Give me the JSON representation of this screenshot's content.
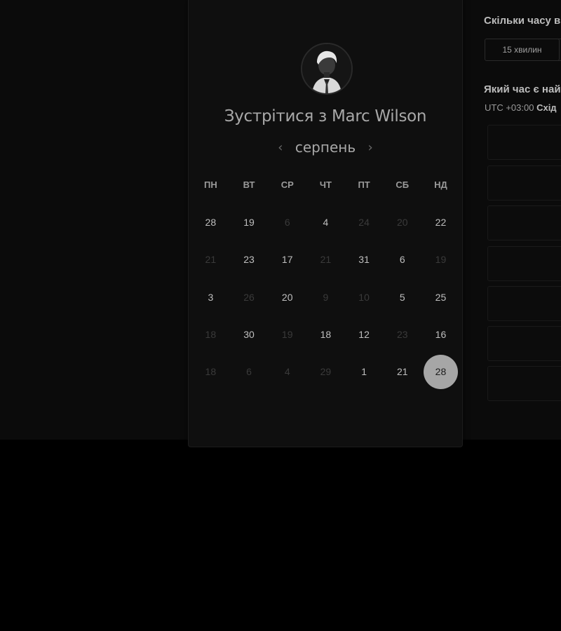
{
  "card": {
    "title_prefix": "Зустрітися з",
    "host_name": "Marc Wilson",
    "month": "серпень",
    "weekdays": [
      "ПН",
      "ВТ",
      "СР",
      "ЧТ",
      "ПТ",
      "СБ",
      "НД"
    ],
    "weeks": [
      [
        {
          "d": "28",
          "off": false
        },
        {
          "d": "19",
          "off": false
        },
        {
          "d": "6",
          "off": true
        },
        {
          "d": "4",
          "off": false
        },
        {
          "d": "24",
          "off": true
        },
        {
          "d": "20",
          "off": true
        },
        {
          "d": "22",
          "off": false
        }
      ],
      [
        {
          "d": "21",
          "off": true
        },
        {
          "d": "23",
          "off": false
        },
        {
          "d": "17",
          "off": false
        },
        {
          "d": "21",
          "off": true
        },
        {
          "d": "31",
          "off": false
        },
        {
          "d": "6",
          "off": false
        },
        {
          "d": "19",
          "off": true
        }
      ],
      [
        {
          "d": "3",
          "off": false
        },
        {
          "d": "26",
          "off": true
        },
        {
          "d": "20",
          "off": false
        },
        {
          "d": "9",
          "off": true
        },
        {
          "d": "10",
          "off": true
        },
        {
          "d": "5",
          "off": false
        },
        {
          "d": "25",
          "off": false
        }
      ],
      [
        {
          "d": "18",
          "off": true
        },
        {
          "d": "30",
          "off": false
        },
        {
          "d": "19",
          "off": true
        },
        {
          "d": "18",
          "off": false
        },
        {
          "d": "12",
          "off": false
        },
        {
          "d": "23",
          "off": true
        },
        {
          "d": "16",
          "off": false
        }
      ],
      [
        {
          "d": "18",
          "off": true
        },
        {
          "d": "6",
          "off": true
        },
        {
          "d": "4",
          "off": true
        },
        {
          "d": "29",
          "off": true
        },
        {
          "d": "1",
          "off": false
        },
        {
          "d": "21",
          "off": false
        },
        {
          "d": "28",
          "off": false,
          "selected": true
        }
      ]
    ],
    "prev_icon": "‹",
    "next_icon": "›"
  },
  "panel": {
    "duration_heading": "Скільки часу в",
    "duration_option": "15 хвилин",
    "time_heading": "Який час є най",
    "tz_offset": "UTC +03:00",
    "tz_name": "Схід"
  }
}
